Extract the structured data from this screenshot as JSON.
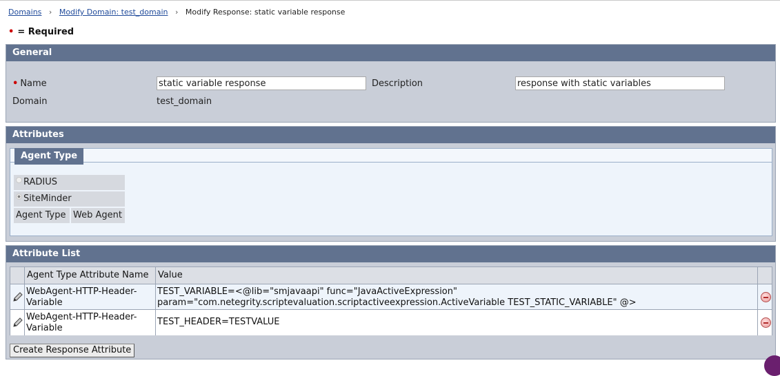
{
  "breadcrumb": {
    "domains": "Domains",
    "modify_domain": "Modify Domain: test_domain",
    "current": "Modify Response: static variable response",
    "separator": "›"
  },
  "required_note": "= Required",
  "general": {
    "title": "General",
    "name_label": "Name",
    "name_value": "static variable response",
    "description_label": "Description",
    "description_value": "response with static variables",
    "domain_label": "Domain",
    "domain_value": "test_domain"
  },
  "attributes": {
    "title": "Attributes",
    "agent_type_tab": "Agent Type",
    "options": [
      {
        "label": "RADIUS",
        "selected": false
      },
      {
        "label": "SiteMinder",
        "selected": true
      }
    ],
    "agent_type_label": "Agent Type",
    "agent_type_value": "Web Agent"
  },
  "attribute_list": {
    "title": "Attribute List",
    "columns": [
      "Agent Type Attribute Name",
      "Value"
    ],
    "rows": [
      {
        "name_line1": "WebAgent-HTTP-Header-",
        "name_line2": "Variable",
        "value_line1": "TEST_VARIABLE=<@lib=\"smjavaapi\" func=\"JavaActiveExpression\"",
        "value_line2": "param=\"com.netegrity.scriptevaluation.scriptactiveexpression.ActiveVariable TEST_STATIC_VARIABLE\" @>"
      },
      {
        "name_line1": "WebAgent-HTTP-Header-",
        "name_line2": "Variable",
        "value_line1": "TEST_HEADER=TESTVALUE",
        "value_line2": ""
      }
    ],
    "create_button": "Create Response Attribute"
  },
  "colors": {
    "section_header": "#61728f",
    "section_body": "#c9ced8",
    "required_dot": "#cc0000",
    "link": "#1f4a9a"
  },
  "icons": [
    "pencil-icon",
    "remove-icon",
    "bullet-required-icon"
  ]
}
